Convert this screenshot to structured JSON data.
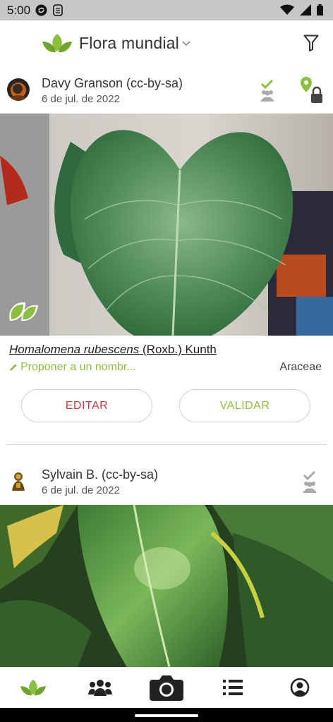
{
  "status_bar": {
    "time": "5:00"
  },
  "header": {
    "title": "Flora mundial"
  },
  "observations": [
    {
      "author": "Davy Granson (cc-by-sa)",
      "date": "6 de jul. de 2022",
      "species_name": "Homalomena rubescens",
      "species_authority": "(Roxb.) Kunth",
      "propose_label": "Proponer a un nombr...",
      "family": "Araceae",
      "edit_label": "EDITAR",
      "validate_label": "VALIDAR"
    },
    {
      "author": "Sylvain B. (cc-by-sa)",
      "date": "6 de jul. de 2022"
    }
  ],
  "colors": {
    "brand_green": "#8cbf3f",
    "edit_red": "#d03a3a",
    "status_grey": "#c6c6c6"
  },
  "bottom_nav": [
    "leaf-icon",
    "community-icon",
    "camera-icon",
    "list-icon",
    "profile-icon"
  ]
}
